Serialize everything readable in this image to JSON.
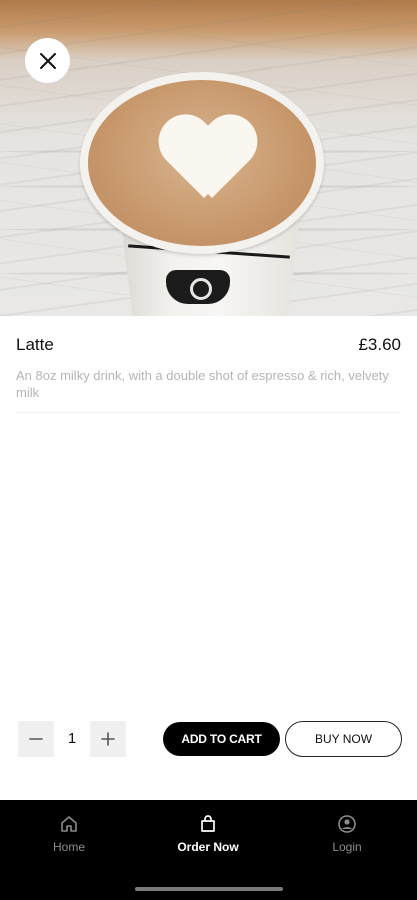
{
  "product": {
    "name": "Latte",
    "price": "£3.60",
    "description": "An 8oz milky drink, with a double shot of espresso & rich, velvety milk",
    "image_icon": "latte-photo"
  },
  "quantity": {
    "value": "1",
    "minus_icon": "minus-icon",
    "plus_icon": "plus-icon"
  },
  "actions": {
    "add_to_cart": "ADD TO CART",
    "buy_now": "BUY NOW"
  },
  "nav": {
    "items": [
      {
        "label": "Home",
        "icon": "home-icon",
        "active": false
      },
      {
        "label": "Order Now",
        "icon": "bag-icon",
        "active": true
      },
      {
        "label": "Login",
        "icon": "user-circle-icon",
        "active": false
      }
    ]
  },
  "colors": {
    "primary": "#000000",
    "nav_inactive": "#8c8c8c",
    "description_text": "#b5b5b5",
    "qty_button_bg": "#f0f0f0"
  }
}
